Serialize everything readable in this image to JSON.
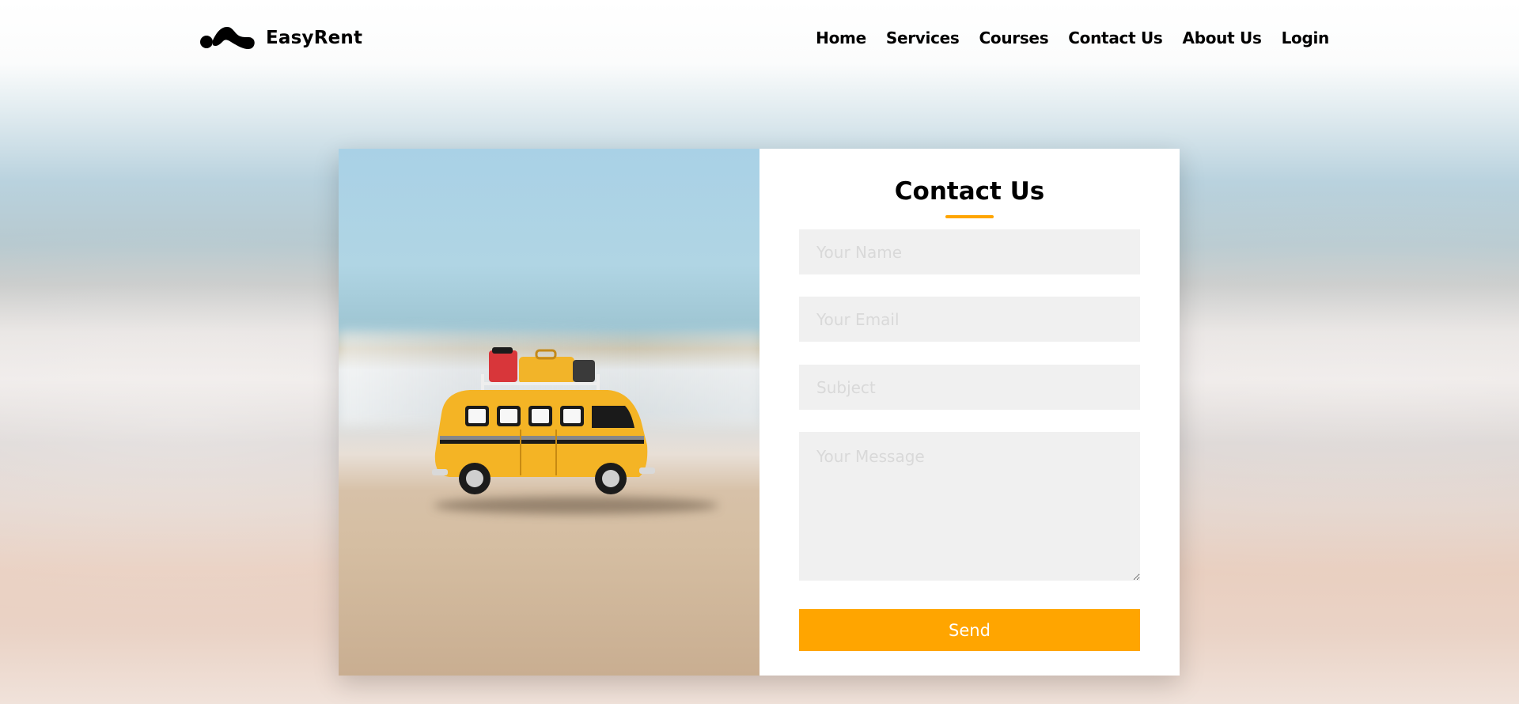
{
  "brand": {
    "name": "EasyRent",
    "logo_icon": "blob-link-icon"
  },
  "nav": {
    "items": [
      {
        "label": "Home"
      },
      {
        "label": "Services"
      },
      {
        "label": "Courses"
      },
      {
        "label": "Contact Us"
      },
      {
        "label": "About Us"
      },
      {
        "label": "Login"
      }
    ]
  },
  "image": {
    "subject": "toy-bus-on-beach-image"
  },
  "contact_form": {
    "title": "Contact Us",
    "name_placeholder": "Your Name",
    "email_placeholder": "Your Email",
    "subject_placeholder": "Subject",
    "message_placeholder": "Your Message",
    "send_label": "Send"
  },
  "colors": {
    "accent": "#ffa500",
    "field_bg": "#f0f0f0",
    "text": "#000000",
    "card_bg": "#ffffff"
  }
}
